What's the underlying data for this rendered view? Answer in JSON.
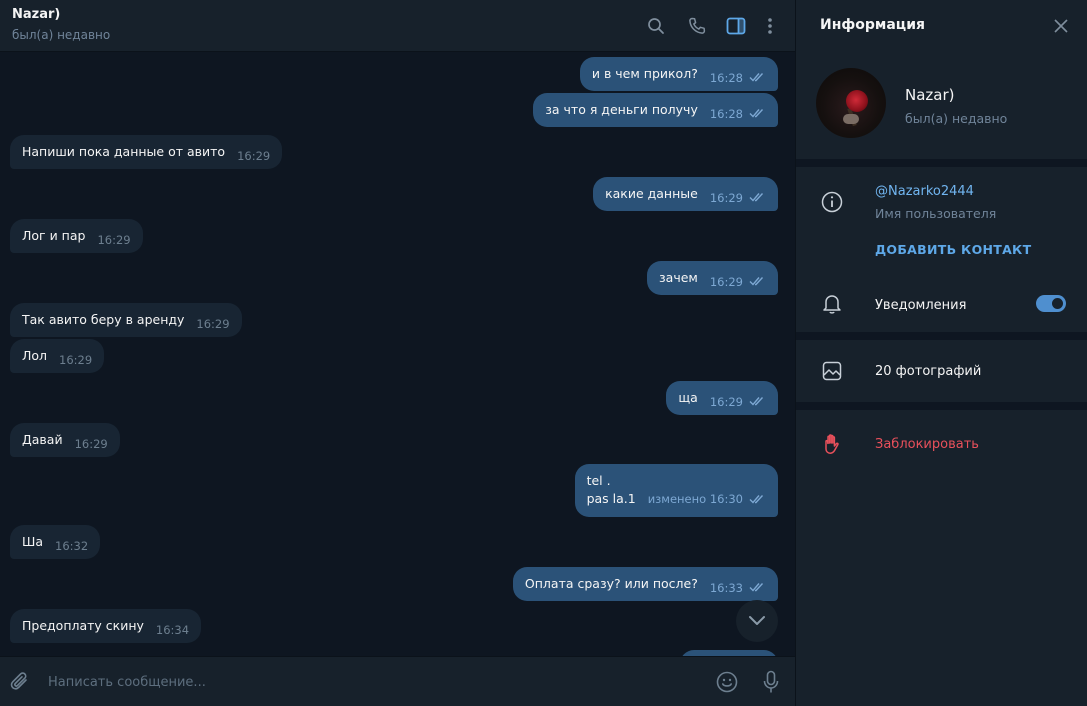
{
  "header": {
    "peer_name": "Nazar)",
    "peer_status": "был(а) недавно"
  },
  "messages": [
    {
      "dir": "out",
      "text": "и в чем прикол?",
      "time": "16:28"
    },
    {
      "dir": "out",
      "text": "за что я деньги получу",
      "time": "16:28"
    },
    {
      "dir": "in",
      "text": "Напиши пока данные от авито",
      "time": "16:29"
    },
    {
      "dir": "out",
      "text": "какие данные",
      "time": "16:29"
    },
    {
      "dir": "in",
      "text": "Лог и пар",
      "time": "16:29"
    },
    {
      "dir": "out",
      "text": "зачем",
      "time": "16:29"
    },
    {
      "dir": "in",
      "text": "Так авито беру в аренду",
      "time": "16:29"
    },
    {
      "dir": "in",
      "text": "Лол",
      "time": "16:29"
    },
    {
      "dir": "out",
      "text": "ща",
      "time": "16:29"
    },
    {
      "dir": "in",
      "text": "Давай",
      "time": "16:29"
    },
    {
      "dir": "out",
      "line1": "tel .",
      "line2": "pas la.1",
      "time": "изменено 16:30"
    },
    {
      "dir": "in",
      "text": "Ша",
      "time": "16:32"
    },
    {
      "dir": "out",
      "text": "Оплата сразу? или после?",
      "time": "16:33"
    },
    {
      "dir": "in",
      "text": "Предоплату скину",
      "time": "16:34"
    }
  ],
  "composer": {
    "placeholder": "Написать сообщение..."
  },
  "info": {
    "title": "Информация",
    "name": "Nazar)",
    "status": "был(а) недавно",
    "username": "@Nazarko2444",
    "username_label": "Имя пользователя",
    "add_contact": "ДОБАВИТЬ КОНТАКТ",
    "notifications": "Уведомления",
    "notifications_on": true,
    "photos": "20 фотографий",
    "block": "Заблокировать"
  },
  "colors": {
    "bg": "#0e1621",
    "panel": "#17212b",
    "bubble_in": "#182533",
    "bubble_out": "#2b5278",
    "accent": "#5ea8e8",
    "danger": "#e8505b"
  }
}
